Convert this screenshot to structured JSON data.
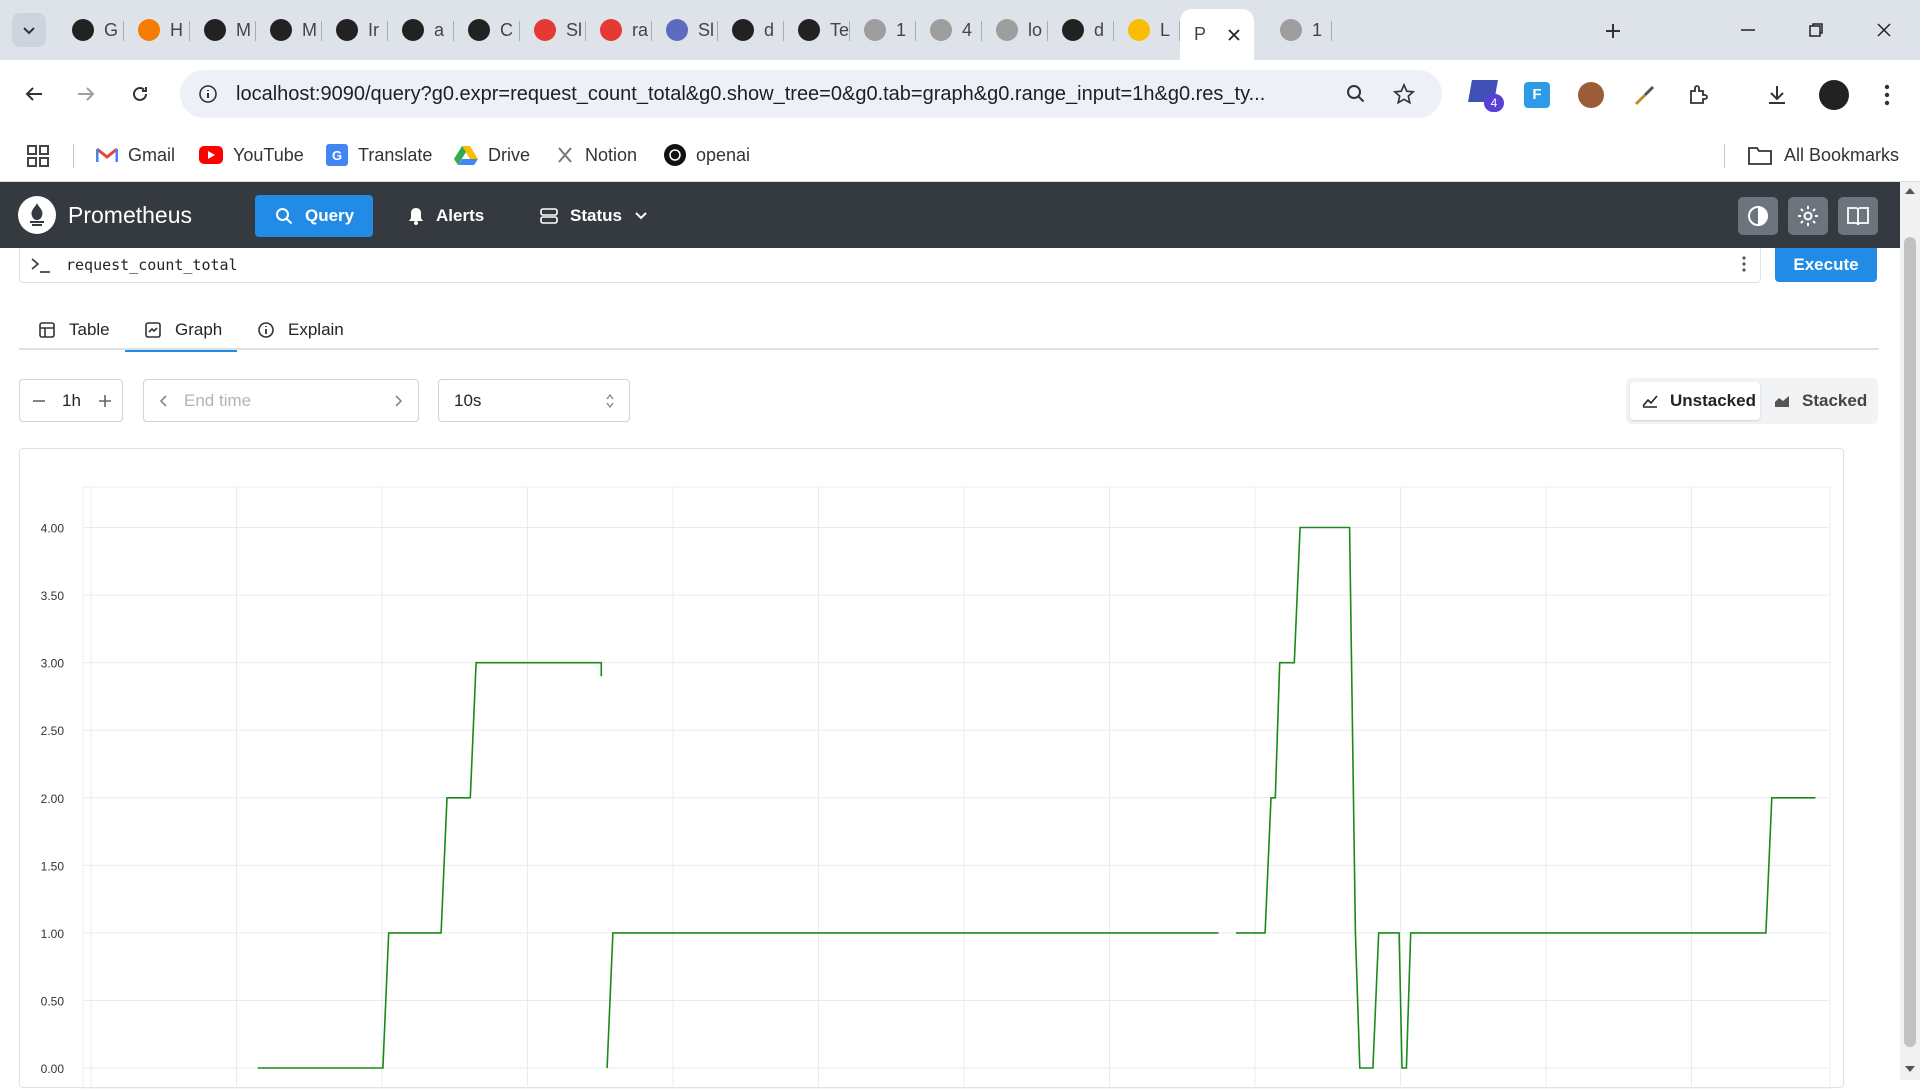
{
  "browser": {
    "tabs": [
      {
        "label": "G",
        "color": "#222"
      },
      {
        "label": "H",
        "color": "#f57c00"
      },
      {
        "label": "M",
        "color": "#222"
      },
      {
        "label": "M",
        "color": "#222"
      },
      {
        "label": "Ir",
        "color": "#222"
      },
      {
        "label": "a",
        "color": "#222"
      },
      {
        "label": "C",
        "color": "#222"
      },
      {
        "label": "Sl",
        "color": "#e53935"
      },
      {
        "label": "ra",
        "color": "#e53935"
      },
      {
        "label": "Sl",
        "color": "#5c6bc0"
      },
      {
        "label": "d",
        "color": "#222"
      },
      {
        "label": "Te",
        "color": "#222"
      },
      {
        "label": "1",
        "color": "#9e9e9e"
      },
      {
        "label": "4",
        "color": "#9e9e9e"
      },
      {
        "label": "lo",
        "color": "#9e9e9e"
      },
      {
        "label": "d",
        "color": "#222"
      },
      {
        "label": "L",
        "color": "#fbbc04"
      },
      {
        "label": "P",
        "color": "#fff",
        "active": true
      },
      {
        "label": "1",
        "color": "#9e9e9e"
      }
    ],
    "url": "localhost:9090/query?g0.expr=request_count_total&g0.show_tree=0&g0.tab=graph&g0.range_input=1h&g0.res_ty...",
    "extension_badge": "4",
    "bookmarks": [
      "Gmail",
      "YouTube",
      "Translate",
      "Drive",
      "Notion",
      "openai"
    ],
    "all_bookmarks": "All Bookmarks"
  },
  "app": {
    "brand": "Prometheus",
    "nav": {
      "query": "Query",
      "alerts": "Alerts",
      "status": "Status"
    },
    "expression": "request_count_total",
    "execute": "Execute",
    "tabs": {
      "table": "Table",
      "graph": "Graph",
      "explain": "Explain"
    },
    "range": "1h",
    "end_time_placeholder": "End time",
    "resolution": "10s",
    "modes": {
      "unstacked": "Unstacked",
      "stacked": "Stacked"
    },
    "series_color": "#1a8a1a",
    "accent": "#228be6"
  },
  "chart_data": {
    "type": "line",
    "ylim": [
      0,
      4.3
    ],
    "yticks": [
      "0.00",
      "0.50",
      "1.00",
      "1.50",
      "2.00",
      "2.50",
      "3.00",
      "3.50",
      "4.00"
    ],
    "xlim": [
      0,
      60
    ],
    "grid": true,
    "series": [
      {
        "segments": [
          [
            [
              6,
              0
            ],
            [
              10.3,
              0
            ],
            [
              10.5,
              1
            ],
            [
              12.3,
              1
            ],
            [
              12.5,
              2
            ],
            [
              13.3,
              2
            ],
            [
              13.5,
              3
            ],
            [
              17.8,
              3
            ],
            [
              17.8,
              2.9
            ]
          ],
          [
            [
              18.0,
              0
            ],
            [
              18.2,
              1
            ],
            [
              39.0,
              1
            ]
          ],
          [
            [
              39.6,
              1
            ],
            [
              40.6,
              1
            ],
            [
              40.8,
              2
            ],
            [
              40.95,
              2
            ],
            [
              41.1,
              3
            ],
            [
              41.6,
              3
            ],
            [
              41.8,
              4
            ],
            [
              43.5,
              4
            ],
            [
              43.7,
              1.0
            ],
            [
              43.85,
              0
            ],
            [
              44.3,
              0
            ],
            [
              44.5,
              1
            ],
            [
              45.2,
              1
            ],
            [
              45.3,
              0
            ],
            [
              45.45,
              0
            ],
            [
              45.6,
              1
            ],
            [
              57.8,
              1
            ],
            [
              58.0,
              2
            ],
            [
              59.5,
              2
            ]
          ]
        ]
      }
    ]
  }
}
